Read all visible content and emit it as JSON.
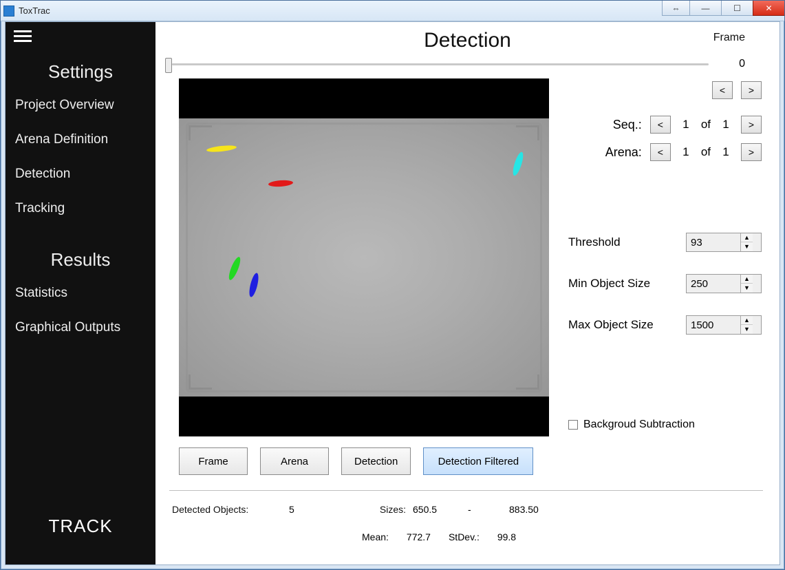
{
  "app": {
    "title": "ToxTrac"
  },
  "sidebar": {
    "settings_header": "Settings",
    "results_header": "Results",
    "items": {
      "project": "Project Overview",
      "arena": "Arena Definition",
      "detection": "Detection",
      "tracking": "Tracking",
      "statistics": "Statistics",
      "graphical": "Graphical Outputs"
    },
    "track_button": "TRACK"
  },
  "page": {
    "title": "Detection",
    "frame_label": "Frame",
    "frame_value": "0"
  },
  "nav": {
    "prev": "<",
    "next": ">",
    "seq_label": "Seq.:",
    "seq_cur": "1",
    "of": "of",
    "seq_total": "1",
    "arena_label": "Arena:",
    "arena_cur": "1",
    "arena_total": "1"
  },
  "params": {
    "threshold_label": "Threshold",
    "threshold_value": "93",
    "min_label": "Min Object Size",
    "min_value": "250",
    "max_label": "Max Object Size",
    "max_value": "1500",
    "bg_sub_label": "Backgroud Subtraction"
  },
  "tabs": {
    "frame": "Frame",
    "arena": "Arena",
    "detection": "Detection",
    "filtered": "Detection Filtered"
  },
  "stats": {
    "detected_label": "Detected Objects:",
    "detected_value": "5",
    "sizes_label": "Sizes:",
    "sizes_min": "650.5",
    "dash": "-",
    "sizes_max": "883.50",
    "mean_label": "Mean:",
    "mean_value": "772.7",
    "stdev_label": "StDev.:",
    "stdev_value": "99.8"
  }
}
